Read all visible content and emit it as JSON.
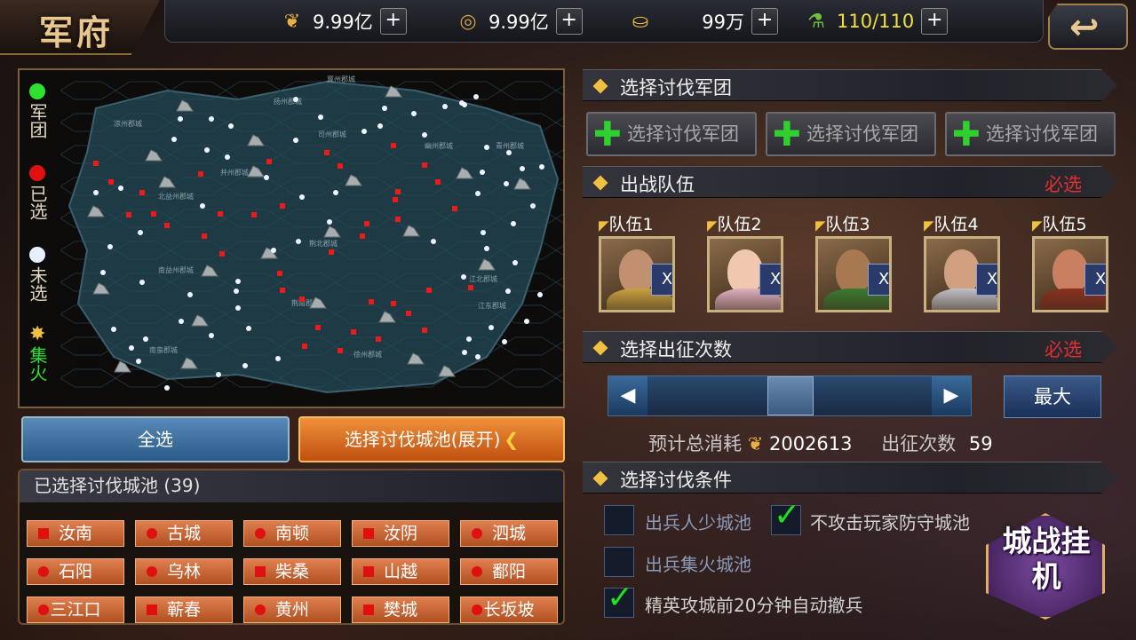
{
  "title": "军府",
  "resources": [
    {
      "icon": "wheat-icon",
      "value": "9.99亿"
    },
    {
      "icon": "coin-icon",
      "value": "9.99亿"
    },
    {
      "icon": "ingot-icon",
      "value": "99万"
    },
    {
      "icon": "stamina-icon",
      "value": "110/110",
      "color": "#f0e040"
    }
  ],
  "plus_label": "+",
  "legend": [
    {
      "label": "军团",
      "color": "#30e030"
    },
    {
      "label": "已选",
      "color": "#e01010"
    },
    {
      "label": "未选",
      "color": "#e8f0ff"
    },
    {
      "label": "集火",
      "color": "#f0c040"
    }
  ],
  "map": {
    "regions": [
      "凉州郡城",
      "冀州郡城",
      "司州郡城",
      "幽州郡城",
      "青州郡城",
      "并州郡城",
      "北益州郡城",
      "荆北郡城",
      "徐州郡城",
      "南益州郡城",
      "江北郡城",
      "荆南郡城",
      "江东郡城",
      "南蛮郡城",
      "扬州郡城"
    ]
  },
  "buttons": {
    "select_all": "全选",
    "select_cities": "选择讨伐城池(展开)",
    "max": "最大",
    "legion_select": "选择讨伐军团"
  },
  "selected": {
    "header": "已选择讨伐城池 (39)",
    "cities": [
      {
        "name": "汝南",
        "shape": "square"
      },
      {
        "name": "古城",
        "shape": "circle"
      },
      {
        "name": "南顿",
        "shape": "circle"
      },
      {
        "name": "汝阴",
        "shape": "square"
      },
      {
        "name": "泗城",
        "shape": "circle"
      },
      {
        "name": "石阳",
        "shape": "circle"
      },
      {
        "name": "乌林",
        "shape": "circle"
      },
      {
        "name": "柴桑",
        "shape": "square"
      },
      {
        "name": "山越",
        "shape": "square"
      },
      {
        "name": "鄱阳",
        "shape": "circle"
      },
      {
        "name": "三江口",
        "shape": "circle"
      },
      {
        "name": "蕲春",
        "shape": "square"
      },
      {
        "name": "黄州",
        "shape": "circle"
      },
      {
        "name": "樊城",
        "shape": "square"
      },
      {
        "name": "长坂坡",
        "shape": "circle"
      }
    ]
  },
  "sections": {
    "legion": "选择讨伐军团",
    "team": "出战队伍",
    "count": "选择出征次数",
    "cond": "选择讨伐条件",
    "required": "必选"
  },
  "teams": [
    {
      "label": "队伍1",
      "remove": "X"
    },
    {
      "label": "队伍2",
      "remove": "X"
    },
    {
      "label": "队伍3",
      "remove": "X"
    },
    {
      "label": "队伍4",
      "remove": "X"
    },
    {
      "label": "队伍5",
      "remove": "X"
    }
  ],
  "slider": {
    "value_fraction": 0.5
  },
  "cost": {
    "label": "预计总消耗",
    "value": "2002613",
    "count_label": "出征次数",
    "count_value": "59"
  },
  "conditions": [
    {
      "label": "出兵人少城池",
      "checked": false
    },
    {
      "label": "不攻击玩家防守城池",
      "checked": true
    },
    {
      "label": "出兵集火城池",
      "checked": false
    },
    {
      "label": "精英攻城前20分钟自动撤兵",
      "checked": true
    }
  ],
  "auto_battle": "城战挂机"
}
